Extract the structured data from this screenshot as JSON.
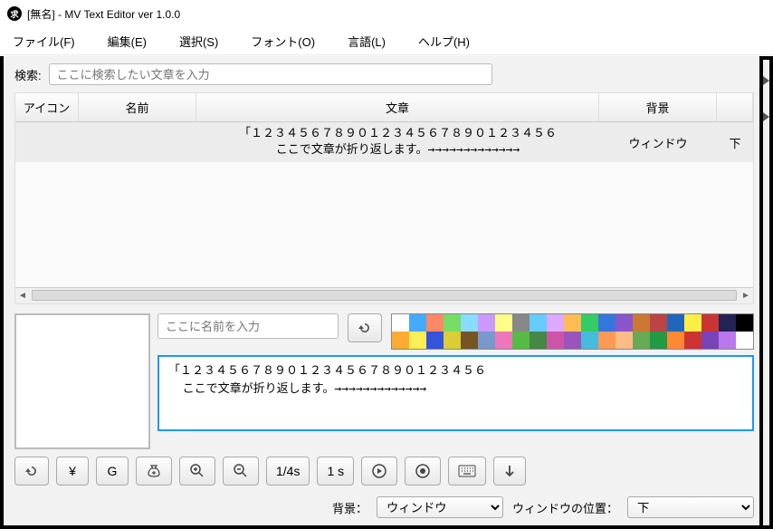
{
  "window": {
    "title": "[無名] - MV Text Editor ver 1.0.0"
  },
  "menu": {
    "file": "ファイル(F)",
    "edit": "編集(E)",
    "select": "選択(S)",
    "font": "フォント(O)",
    "lang": "言語(L)",
    "help": "ヘルプ(H)"
  },
  "search": {
    "label": "検索:",
    "placeholder": "ここに検索したい文章を入力"
  },
  "table": {
    "headers": {
      "icon": "アイコン",
      "name": "名前",
      "text": "文章",
      "bg": "背景",
      "pos": ""
    },
    "rows": [
      {
        "icon": "",
        "name": "",
        "text": "「１２３４５６７８９０１２３４５６７８９０１２３４５６\nここで文章が折り返します。→→→→→→→→→→→→→",
        "bg": "ウィンドウ",
        "pos": "下"
      }
    ]
  },
  "editor": {
    "name_placeholder": "ここに名前を入力",
    "text": "「１２３４５６７８９０１２３４５６７８９０１２３４５６\n  ここで文章が折り返します。→→→→→→→→→→→→→"
  },
  "palette": [
    [
      "#ffffff",
      "#44aaff",
      "#ff8866",
      "#77dd66",
      "#88ddff",
      "#cc99ff",
      "#ffff88",
      "#888888",
      "#66ccff",
      "#ddaaff",
      "#ffbb55",
      "#33cc66",
      "#3377dd",
      "#8855cc",
      "#cc7733",
      "#bb4444",
      "#2266bb",
      "#ffee44",
      "#cc3333",
      "#222255",
      "#000000"
    ],
    [
      "#ffaa33",
      "#ffee55",
      "#3355dd",
      "#ddcc33",
      "#775522",
      "#7799cc",
      "#ee77bb",
      "#55bb44",
      "#448844",
      "#cc55aa",
      "#9955bb",
      "#44bbdd",
      "#ff9955",
      "#ffbb88",
      "#66aa55",
      "#229944",
      "#ff8833",
      "#cc3333",
      "#7744bb",
      "#bb77ee",
      "#ffffff"
    ]
  ],
  "toolbar": {
    "undo": "↺",
    "yen": "¥",
    "g": "G",
    "bag": "bag",
    "zoomIn": "+",
    "zoomOut": "-",
    "quarter": "1/4s",
    "one": "1 s",
    "target": "◎",
    "stop": "◉",
    "keyboard": "⌨",
    "down": "↓"
  },
  "bottom": {
    "bg_label": "背景：",
    "bg_value": "ウィンドウ",
    "pos_label": "ウィンドウの位置：",
    "pos_value": "下"
  }
}
